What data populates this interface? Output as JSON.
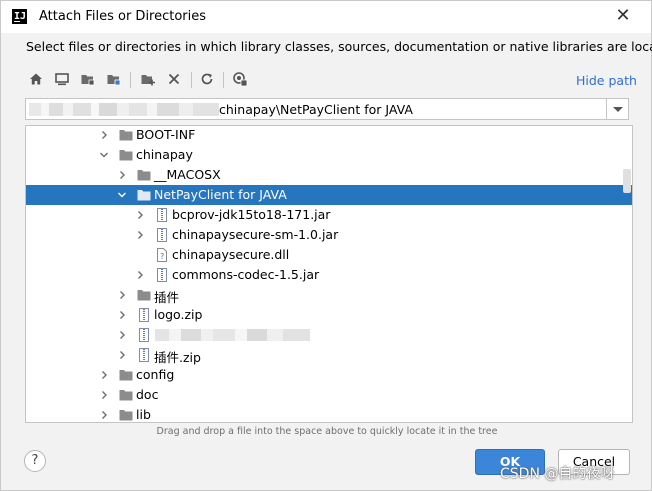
{
  "window": {
    "title": "Attach Files or Directories",
    "close_glyph": "✕"
  },
  "description": "Select files or directories in which library classes, sources, documentation or native libraries are located",
  "toolbar": {
    "icons": [
      "home-icon",
      "desktop-icon",
      "project-icon",
      "module-icon",
      "new-folder-icon",
      "delete-icon",
      "refresh-icon",
      "show-hidden-icon"
    ],
    "hide_path_label": "Hide path"
  },
  "path_field": {
    "value": "chinapay\\NetPayClient for JAVA"
  },
  "tree": {
    "items": [
      {
        "label": "BOOT-INF",
        "level": 0,
        "type": "folder",
        "expander": "collapsed",
        "selected": false
      },
      {
        "label": "chinapay",
        "level": 0,
        "type": "folder",
        "expander": "expanded",
        "selected": false
      },
      {
        "label": "__MACOSX",
        "level": 1,
        "type": "folder",
        "expander": "collapsed",
        "selected": false
      },
      {
        "label": "NetPayClient for JAVA",
        "level": 1,
        "type": "folder",
        "expander": "expanded",
        "selected": true
      },
      {
        "label": "bcprov-jdk15to18-171.jar",
        "level": 2,
        "type": "archive",
        "expander": "collapsed",
        "selected": false
      },
      {
        "label": "chinapaysecure-sm-1.0.jar",
        "level": 2,
        "type": "archive",
        "expander": "collapsed",
        "selected": false
      },
      {
        "label": "chinapaysecure.dll",
        "level": 2,
        "type": "file-unknown",
        "expander": "none",
        "selected": false
      },
      {
        "label": "commons-codec-1.5.jar",
        "level": 2,
        "type": "archive",
        "expander": "collapsed",
        "selected": false
      },
      {
        "label": "插件",
        "level": 1,
        "type": "folder",
        "expander": "collapsed",
        "selected": false
      },
      {
        "label": "logo.zip",
        "level": 1,
        "type": "archive",
        "expander": "collapsed",
        "selected": false
      },
      {
        "label": "",
        "level": 1,
        "type": "archive",
        "expander": "collapsed",
        "selected": false,
        "obscured": true
      },
      {
        "label": "插件.zip",
        "level": 1,
        "type": "archive",
        "expander": "collapsed",
        "selected": false
      },
      {
        "label": "config",
        "level": 0,
        "type": "folder",
        "expander": "collapsed",
        "selected": false
      },
      {
        "label": "doc",
        "level": 0,
        "type": "folder",
        "expander": "collapsed",
        "selected": false
      },
      {
        "label": "lib",
        "level": 0,
        "type": "folder",
        "expander": "collapsed",
        "selected": false
      }
    ]
  },
  "hint": "Drag and drop a file into the space above to quickly locate it in the tree",
  "buttons": {
    "help": "?",
    "ok": "OK",
    "cancel": "Cancel"
  },
  "watermark": "CSDN @自的夜呀",
  "colors": {
    "selection": "#2675bf",
    "link": "#2f6fd1",
    "ok_button": "#3b86d8"
  }
}
